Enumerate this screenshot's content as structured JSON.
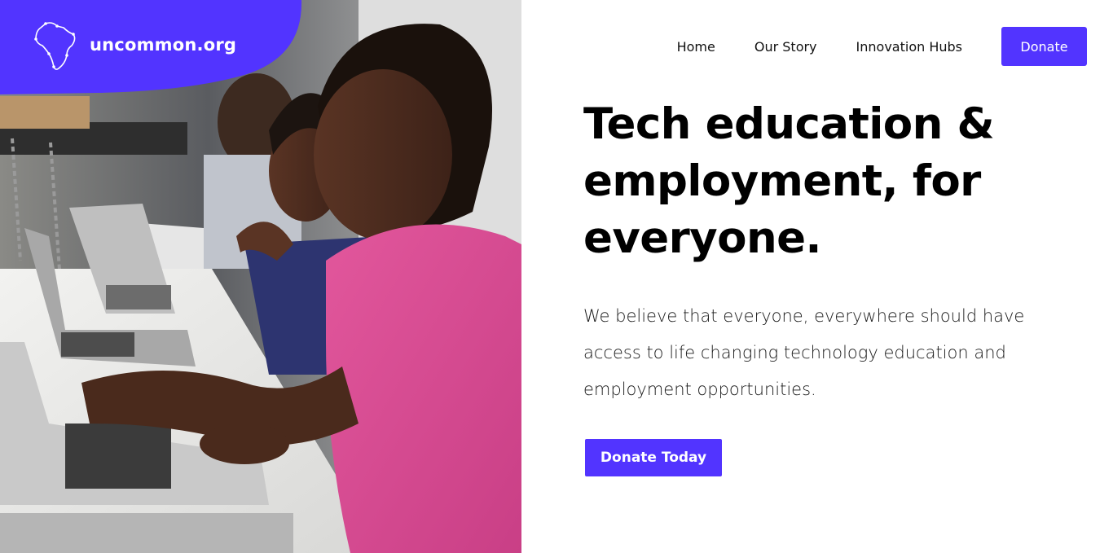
{
  "brand": {
    "name": "uncommon.org",
    "logo_icon": "africa-map-icon",
    "color": "#5234ff"
  },
  "nav": {
    "items": [
      {
        "label": "Home"
      },
      {
        "label": "Our Story"
      },
      {
        "label": "Innovation Hubs"
      }
    ],
    "donate_label": "Donate"
  },
  "hero": {
    "headline_line1": "Tech education &",
    "headline_line2": "employment, for",
    "headline_highlight": "everyone",
    "headline_end": ".",
    "body": "We believe that everyone, everywhere should have access to life changing technology education and employment opportunities.",
    "cta_label": "Donate Today",
    "accent_color": "#5234ff"
  }
}
